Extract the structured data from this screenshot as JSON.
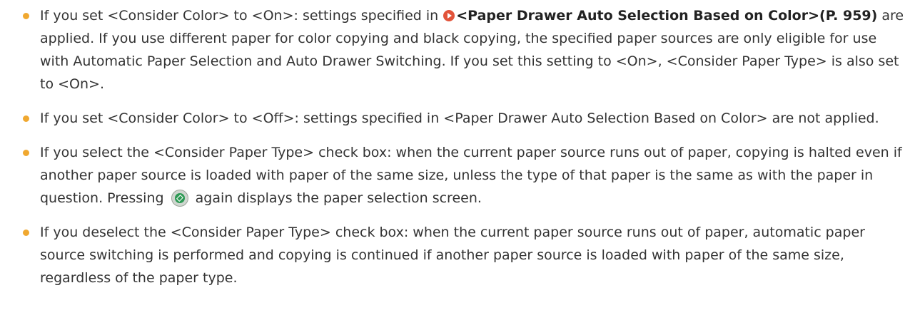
{
  "notes": [
    {
      "pre": "If you set <Consider Color> to <On>: settings specified in ",
      "link": "<Paper Drawer Auto Selection Based on Color>(P. 959)",
      "post": " are applied. If you use different paper for color copying and black copying, the specified paper sources are only eligible for use with Automatic Paper Selection and Auto Drawer Switching. If you set this setting to <On>, <Consider Paper Type> is also set to <On>.",
      "link_icon": "arrow-circle-icon"
    },
    {
      "text": "If you set <Consider Color> to <Off>: settings specified in <Paper Drawer Auto Selection Based on Color> are not applied."
    },
    {
      "pre": "If you select the <Consider Paper Type> check box: when the current paper source runs out of paper, copying is halted even if another paper source is loaded with paper of the same size, unless the type of that paper is the same as with the paper in question. Pressing ",
      "post": " again displays the paper selection screen.",
      "inline_icon": "start-key-icon"
    },
    {
      "text": "If you deselect the <Consider Paper Type> check box: when the current paper source runs out of paper, automatic paper source switching is performed and copying is continued if another paper source is loaded with paper of the same size, regardless of the paper type."
    }
  ],
  "colors": {
    "bullet": "#f0a830",
    "link_icon": "#e2533a",
    "start_icon": "#2e9a55",
    "text": "#333333"
  }
}
